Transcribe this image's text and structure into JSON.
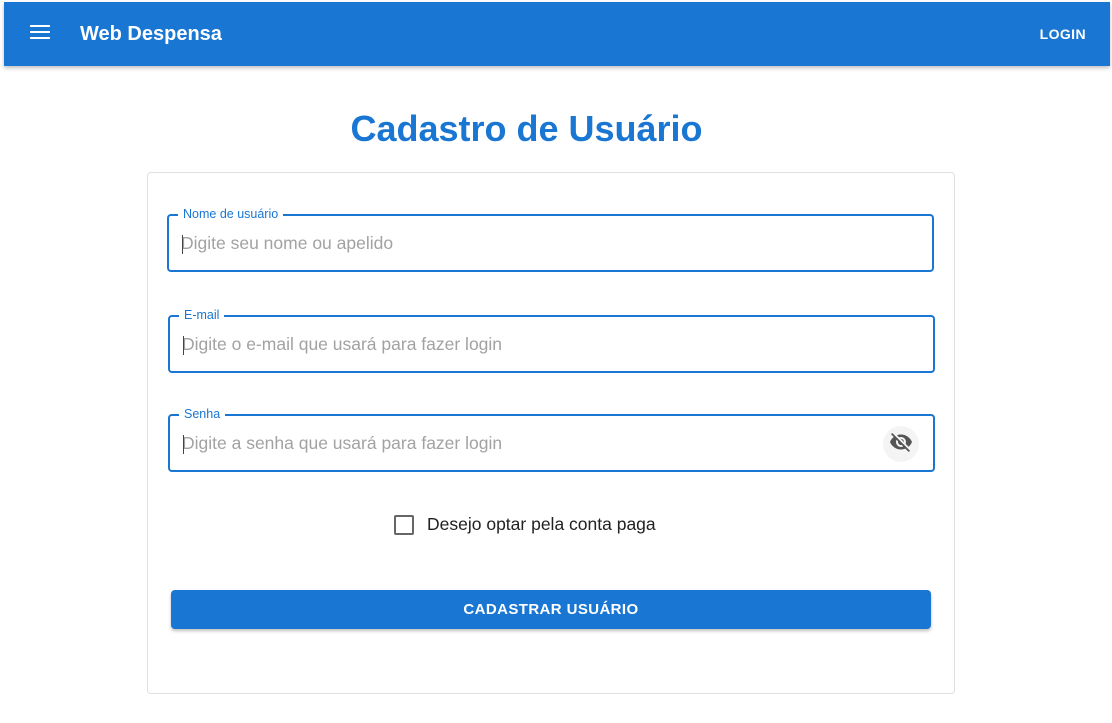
{
  "appbar": {
    "menu_icon": "menu-icon",
    "title": "Web Despensa",
    "login_label": "LOGIN",
    "color": "#1976d2"
  },
  "page": {
    "title": "Cadastro de Usuário"
  },
  "form": {
    "username": {
      "label": "Nome de usuário",
      "placeholder": "Digite seu nome ou apelido",
      "value": ""
    },
    "email": {
      "label": "E-mail",
      "placeholder": "Digite o e-mail que usará para fazer login",
      "value": ""
    },
    "password": {
      "label": "Senha",
      "placeholder": "Digite a senha que usará para fazer login",
      "value": "",
      "toggle_icon": "eye-off-icon"
    },
    "paid_account": {
      "label": "Desejo optar pela conta paga",
      "checked": false
    },
    "submit_label": "CADASTRAR USUÁRIO"
  }
}
